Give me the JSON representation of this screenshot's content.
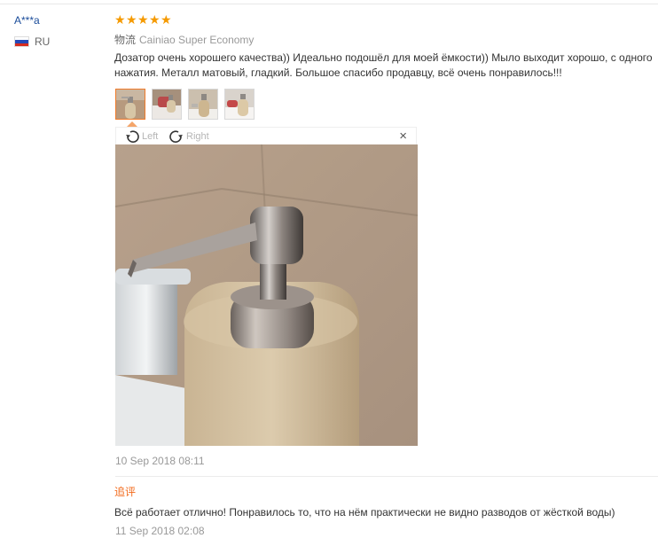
{
  "user": {
    "name": "A***a",
    "country": "RU",
    "flag_icon": "russia-flag-icon"
  },
  "review": {
    "rating": 5,
    "star_char": "★",
    "logistics_label": "物流",
    "logistics_value": "Cainiao Super Economy",
    "text": "Дозатор очень хорошего качества)) Идеально подошёл для моей ёмкости)) Мыло выходит хорошо, с одного нажатия. Металл матовый, гладкий. Большое спасибо продавцу, всё очень понравилось!!!",
    "thumbnail_count": 4,
    "active_thumbnail": 1,
    "date": "10 Sep 2018 08:11"
  },
  "viewer": {
    "rotate_left_label": "Left",
    "rotate_right_label": "Right",
    "close_label": "×"
  },
  "followup": {
    "label": "追评",
    "text": "Всё работает отлично! Понравилось то, что на нём практически не видно разводов от жёсткой воды)",
    "date": "11 Sep 2018 02:08"
  },
  "colors": {
    "star": "#f59a00",
    "username": "#1a4c9a",
    "followup_label": "#f26a1b",
    "active_thumb_border": "#f07b2a",
    "meta_text": "#999999"
  }
}
